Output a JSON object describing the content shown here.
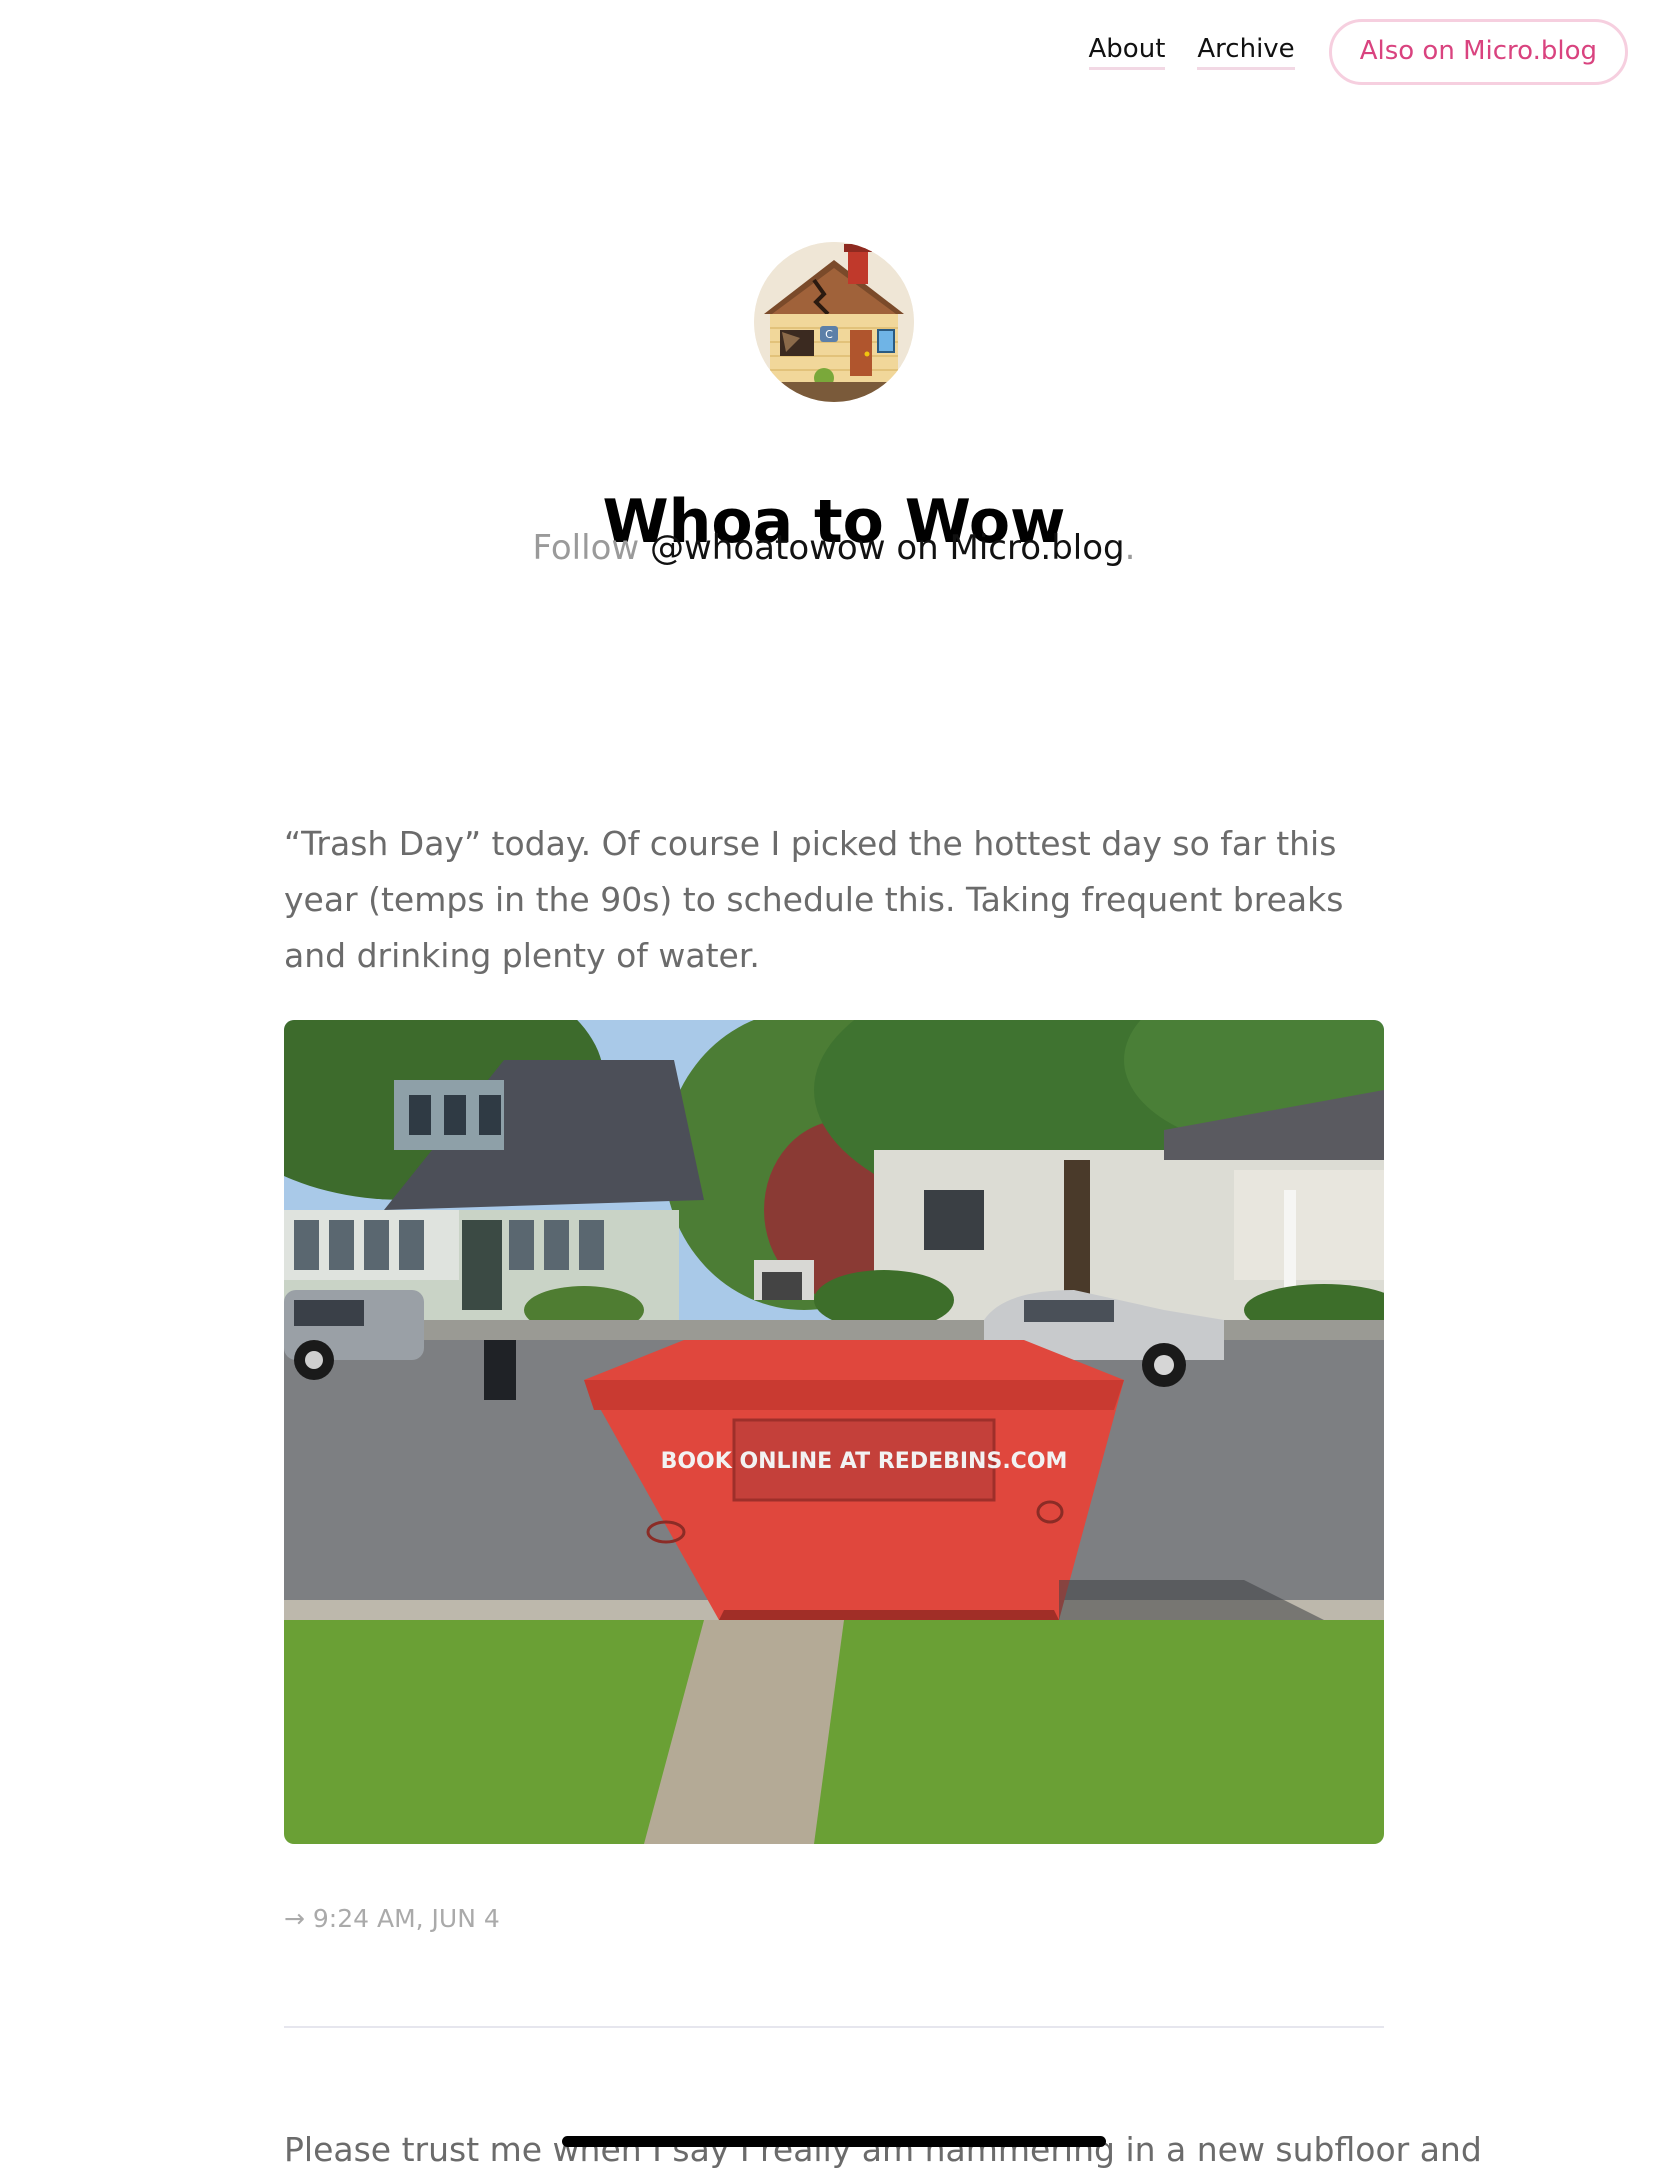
{
  "nav": {
    "about_label": "About",
    "archive_label": "Archive",
    "microblog_label": "Also on Micro.blog"
  },
  "header": {
    "avatar_icon": "house-emoji-avatar",
    "title": "Whoa to Wow",
    "follow_prefix": "Follow",
    "follow_handle": "@whoatowow on Micro.blog",
    "follow_suffix": "."
  },
  "posts": [
    {
      "text": "“Trash Day” today. Of course I picked the hottest day so far this year (temps in the 90s) to schedule this. Taking frequent breaks and drinking plenty of water.",
      "photo_sign_text": "BOOK ONLINE AT REDEBINS.COM",
      "timestamp_arrow": "→",
      "timestamp": "9:24 AM, JUN 4"
    },
    {
      "text": "Please trust me when I say I really am hammering in a new subfloor and"
    }
  ],
  "colors": {
    "accent_pink": "#d9437f",
    "pill_border": "#f6cfdf",
    "link_underline": "#f2d8e4",
    "muted_text": "#6b6b6b"
  }
}
